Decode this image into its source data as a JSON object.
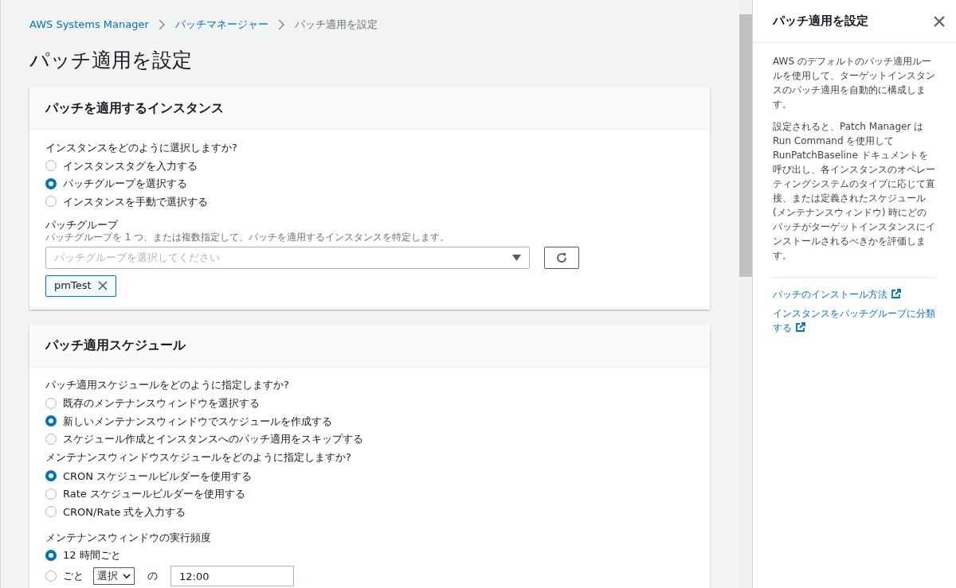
{
  "breadcrumb": [
    {
      "label": "AWS Systems Manager",
      "link": true
    },
    {
      "label": "パッチマネージャー",
      "link": true
    },
    {
      "label": "パッチ適用を設定",
      "link": false
    }
  ],
  "page_title": "パッチ適用を設定",
  "instances_panel": {
    "title": "パッチを適用するインスタンス",
    "question": "インスタンスをどのように選択しますか?",
    "options": [
      {
        "label": "インスタンスタグを入力する",
        "selected": false
      },
      {
        "label": "パッチグループを選択する",
        "selected": true
      },
      {
        "label": "インスタンスを手動で選択する",
        "selected": false
      }
    ],
    "patch_group": {
      "label": "パッチグループ",
      "description": "パッチグループを 1 つ、または複数指定して、パッチを適用するインスタンスを特定します。",
      "placeholder": "パッチグループを選択してください",
      "tokens": [
        "pmTest"
      ]
    }
  },
  "schedule_panel": {
    "title": "パッチ適用スケジュール",
    "groups": [
      {
        "question": "パッチ適用スケジュールをどのように指定しますか?",
        "options": [
          {
            "label": "既存のメンテナンスウィンドウを選択する",
            "selected": false
          },
          {
            "label": "新しいメンテナンスウィンドウでスケジュールを作成する",
            "selected": true
          },
          {
            "label": "スケジュール作成とインスタンスへのパッチ適用をスキップする",
            "selected": false
          }
        ]
      },
      {
        "question": "メンテナンスウィンドウスケジュールをどのように指定しますか?",
        "options": [
          {
            "label": "CRON スケジュールビルダーを使用する",
            "selected": true
          },
          {
            "label": "Rate スケジュールビルダーを使用する",
            "selected": false
          },
          {
            "label": "CRON/Rate 式を入力する",
            "selected": false
          }
        ]
      }
    ],
    "frequency": {
      "label": "メンテナンスウィンドウの実行頻度",
      "option_every_12h": {
        "label": "12 時間ごと",
        "selected": true
      },
      "option_custom": {
        "label": "ごと",
        "selected": false,
        "select_value": "選択",
        "connector": "の",
        "time_value": "12:00"
      }
    }
  },
  "help_panel": {
    "title": "パッチ適用を設定",
    "paragraphs": [
      "AWS のデフォルトのパッチ適用ルールを使用して、ターゲットインスタンスのパッチ適用を自動的に構成します。",
      "設定されると、Patch Manager は Run Command を使用して RunPatchBaseline ドキュメントを呼び出し、各インスタンスのオペレーティングシステムのタイプに応じて直接、または定義されたスケジュール (メンテナンスウィンドウ) 時にどのパッチがターゲットインスタンスにインストールされるべきかを評価します。"
    ],
    "links": [
      "パッチのインストール方法",
      "インスタンスをパッチグループに分類する"
    ]
  }
}
